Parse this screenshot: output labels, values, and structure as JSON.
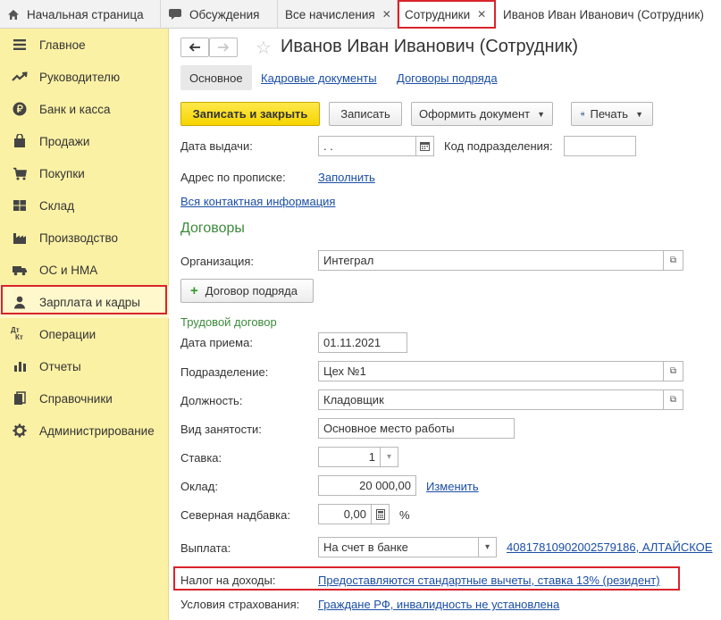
{
  "tabs": [
    {
      "label": "Начальная страница",
      "icon": "home-icon"
    },
    {
      "label": "Обсуждения",
      "icon": "chat-icon"
    },
    {
      "label": "Все начисления",
      "closable": true
    },
    {
      "label": "Сотрудники",
      "closable": true,
      "highlighted": true
    },
    {
      "label": "Иванов Иван Иванович (Сотрудник)",
      "active": true
    }
  ],
  "sidebar": {
    "items": [
      {
        "label": "Главное",
        "icon": "menu-icon"
      },
      {
        "label": "Руководителю",
        "icon": "trend-icon"
      },
      {
        "label": "Банк и касса",
        "icon": "ruble-icon"
      },
      {
        "label": "Продажи",
        "icon": "bag-icon"
      },
      {
        "label": "Покупки",
        "icon": "cart-icon"
      },
      {
        "label": "Склад",
        "icon": "warehouse-icon"
      },
      {
        "label": "Производство",
        "icon": "factory-icon"
      },
      {
        "label": "ОС и НМА",
        "icon": "truck-icon"
      },
      {
        "label": "Зарплата и кадры",
        "icon": "person-icon",
        "highlighted": true
      },
      {
        "label": "Операции",
        "icon": "debit-credit-icon"
      },
      {
        "label": "Отчеты",
        "icon": "bar-chart-icon"
      },
      {
        "label": "Справочники",
        "icon": "book-icon"
      },
      {
        "label": "Администрирование",
        "icon": "gear-icon"
      }
    ]
  },
  "form": {
    "title": "Иванов Иван Иванович (Сотрудник)",
    "subtabs": [
      "Основное",
      "Кадровые документы",
      "Договоры подряда"
    ],
    "toolbar": {
      "save_close": "Записать и закрыть",
      "save": "Записать",
      "make_doc": "Оформить документ",
      "print": "Печать"
    },
    "issue_date_label": "Дата выдачи:",
    "issue_date_value": " .  .",
    "division_code_label": "Код подразделения:",
    "division_code_value": "",
    "address_label": "Адрес по прописке:",
    "address_link": "Заполнить",
    "contact_link": "Вся контактная информация",
    "contracts_header": "Договоры",
    "org_label": "Организация:",
    "org_value": "Интеграл",
    "contract_button": "Договор подряда",
    "labor_header": "Трудовой договор",
    "hire_date_label": "Дата приема:",
    "hire_date_value": "01.11.2021",
    "dept_label": "Подразделение:",
    "dept_value": "Цех №1",
    "position_label": "Должность:",
    "position_value": "Кладовщик",
    "employment_label": "Вид занятости:",
    "employment_value": "Основное место работы",
    "rate_label": "Ставка:",
    "rate_value": "1",
    "salary_label": "Оклад:",
    "salary_value": "20 000,00",
    "salary_link": "Изменить",
    "north_label": "Северная надбавка:",
    "north_value": "0,00",
    "north_unit": "%",
    "payout_label": "Выплата:",
    "payout_value": "На счет в банке",
    "payout_link": "40817810902002579186, АЛТАЙСКОЕ",
    "tax_label": "Налог на доходы:",
    "tax_link": "Предоставляются стандартные вычеты, ставка 13% (резидент)",
    "insurance_label": "Условия страхования:",
    "insurance_link": "Граждане РФ, инвалидность не установлена"
  },
  "colors": {
    "sidebar_bg": "#fbf1a4",
    "primary_button": "#f6d500",
    "highlight_border": "#d9242b",
    "link": "#1a4ea6",
    "section_green": "#3b8a3b"
  }
}
